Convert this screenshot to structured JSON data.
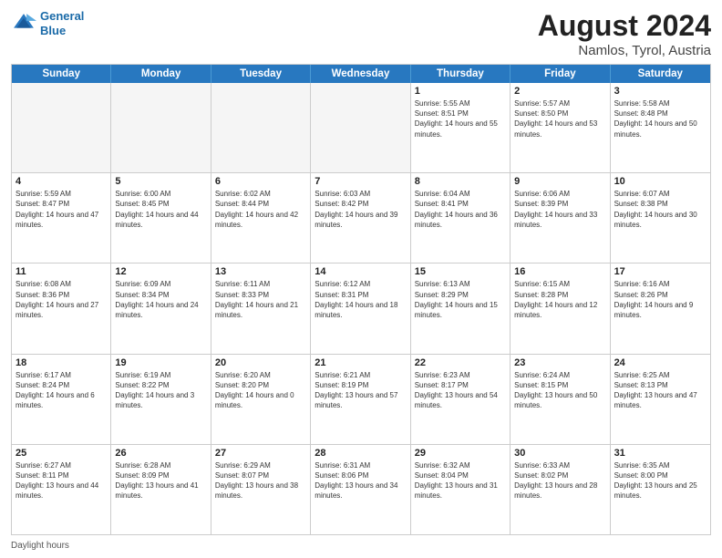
{
  "header": {
    "logo_line1": "General",
    "logo_line2": "Blue",
    "title": "August 2024",
    "subtitle": "Namlos, Tyrol, Austria"
  },
  "days_of_week": [
    "Sunday",
    "Monday",
    "Tuesday",
    "Wednesday",
    "Thursday",
    "Friday",
    "Saturday"
  ],
  "weeks": [
    [
      {
        "day": "",
        "info": ""
      },
      {
        "day": "",
        "info": ""
      },
      {
        "day": "",
        "info": ""
      },
      {
        "day": "",
        "info": ""
      },
      {
        "day": "1",
        "info": "Sunrise: 5:55 AM\nSunset: 8:51 PM\nDaylight: 14 hours and 55 minutes."
      },
      {
        "day": "2",
        "info": "Sunrise: 5:57 AM\nSunset: 8:50 PM\nDaylight: 14 hours and 53 minutes."
      },
      {
        "day": "3",
        "info": "Sunrise: 5:58 AM\nSunset: 8:48 PM\nDaylight: 14 hours and 50 minutes."
      }
    ],
    [
      {
        "day": "4",
        "info": "Sunrise: 5:59 AM\nSunset: 8:47 PM\nDaylight: 14 hours and 47 minutes."
      },
      {
        "day": "5",
        "info": "Sunrise: 6:00 AM\nSunset: 8:45 PM\nDaylight: 14 hours and 44 minutes."
      },
      {
        "day": "6",
        "info": "Sunrise: 6:02 AM\nSunset: 8:44 PM\nDaylight: 14 hours and 42 minutes."
      },
      {
        "day": "7",
        "info": "Sunrise: 6:03 AM\nSunset: 8:42 PM\nDaylight: 14 hours and 39 minutes."
      },
      {
        "day": "8",
        "info": "Sunrise: 6:04 AM\nSunset: 8:41 PM\nDaylight: 14 hours and 36 minutes."
      },
      {
        "day": "9",
        "info": "Sunrise: 6:06 AM\nSunset: 8:39 PM\nDaylight: 14 hours and 33 minutes."
      },
      {
        "day": "10",
        "info": "Sunrise: 6:07 AM\nSunset: 8:38 PM\nDaylight: 14 hours and 30 minutes."
      }
    ],
    [
      {
        "day": "11",
        "info": "Sunrise: 6:08 AM\nSunset: 8:36 PM\nDaylight: 14 hours and 27 minutes."
      },
      {
        "day": "12",
        "info": "Sunrise: 6:09 AM\nSunset: 8:34 PM\nDaylight: 14 hours and 24 minutes."
      },
      {
        "day": "13",
        "info": "Sunrise: 6:11 AM\nSunset: 8:33 PM\nDaylight: 14 hours and 21 minutes."
      },
      {
        "day": "14",
        "info": "Sunrise: 6:12 AM\nSunset: 8:31 PM\nDaylight: 14 hours and 18 minutes."
      },
      {
        "day": "15",
        "info": "Sunrise: 6:13 AM\nSunset: 8:29 PM\nDaylight: 14 hours and 15 minutes."
      },
      {
        "day": "16",
        "info": "Sunrise: 6:15 AM\nSunset: 8:28 PM\nDaylight: 14 hours and 12 minutes."
      },
      {
        "day": "17",
        "info": "Sunrise: 6:16 AM\nSunset: 8:26 PM\nDaylight: 14 hours and 9 minutes."
      }
    ],
    [
      {
        "day": "18",
        "info": "Sunrise: 6:17 AM\nSunset: 8:24 PM\nDaylight: 14 hours and 6 minutes."
      },
      {
        "day": "19",
        "info": "Sunrise: 6:19 AM\nSunset: 8:22 PM\nDaylight: 14 hours and 3 minutes."
      },
      {
        "day": "20",
        "info": "Sunrise: 6:20 AM\nSunset: 8:20 PM\nDaylight: 14 hours and 0 minutes."
      },
      {
        "day": "21",
        "info": "Sunrise: 6:21 AM\nSunset: 8:19 PM\nDaylight: 13 hours and 57 minutes."
      },
      {
        "day": "22",
        "info": "Sunrise: 6:23 AM\nSunset: 8:17 PM\nDaylight: 13 hours and 54 minutes."
      },
      {
        "day": "23",
        "info": "Sunrise: 6:24 AM\nSunset: 8:15 PM\nDaylight: 13 hours and 50 minutes."
      },
      {
        "day": "24",
        "info": "Sunrise: 6:25 AM\nSunset: 8:13 PM\nDaylight: 13 hours and 47 minutes."
      }
    ],
    [
      {
        "day": "25",
        "info": "Sunrise: 6:27 AM\nSunset: 8:11 PM\nDaylight: 13 hours and 44 minutes."
      },
      {
        "day": "26",
        "info": "Sunrise: 6:28 AM\nSunset: 8:09 PM\nDaylight: 13 hours and 41 minutes."
      },
      {
        "day": "27",
        "info": "Sunrise: 6:29 AM\nSunset: 8:07 PM\nDaylight: 13 hours and 38 minutes."
      },
      {
        "day": "28",
        "info": "Sunrise: 6:31 AM\nSunset: 8:06 PM\nDaylight: 13 hours and 34 minutes."
      },
      {
        "day": "29",
        "info": "Sunrise: 6:32 AM\nSunset: 8:04 PM\nDaylight: 13 hours and 31 minutes."
      },
      {
        "day": "30",
        "info": "Sunrise: 6:33 AM\nSunset: 8:02 PM\nDaylight: 13 hours and 28 minutes."
      },
      {
        "day": "31",
        "info": "Sunrise: 6:35 AM\nSunset: 8:00 PM\nDaylight: 13 hours and 25 minutes."
      }
    ]
  ],
  "footer": {
    "note": "Daylight hours"
  },
  "colors": {
    "header_bg": "#2878c0",
    "header_text": "#ffffff",
    "border": "#cccccc",
    "alt_bg": "#f0f0f0",
    "empty_bg": "#f5f5f5"
  }
}
